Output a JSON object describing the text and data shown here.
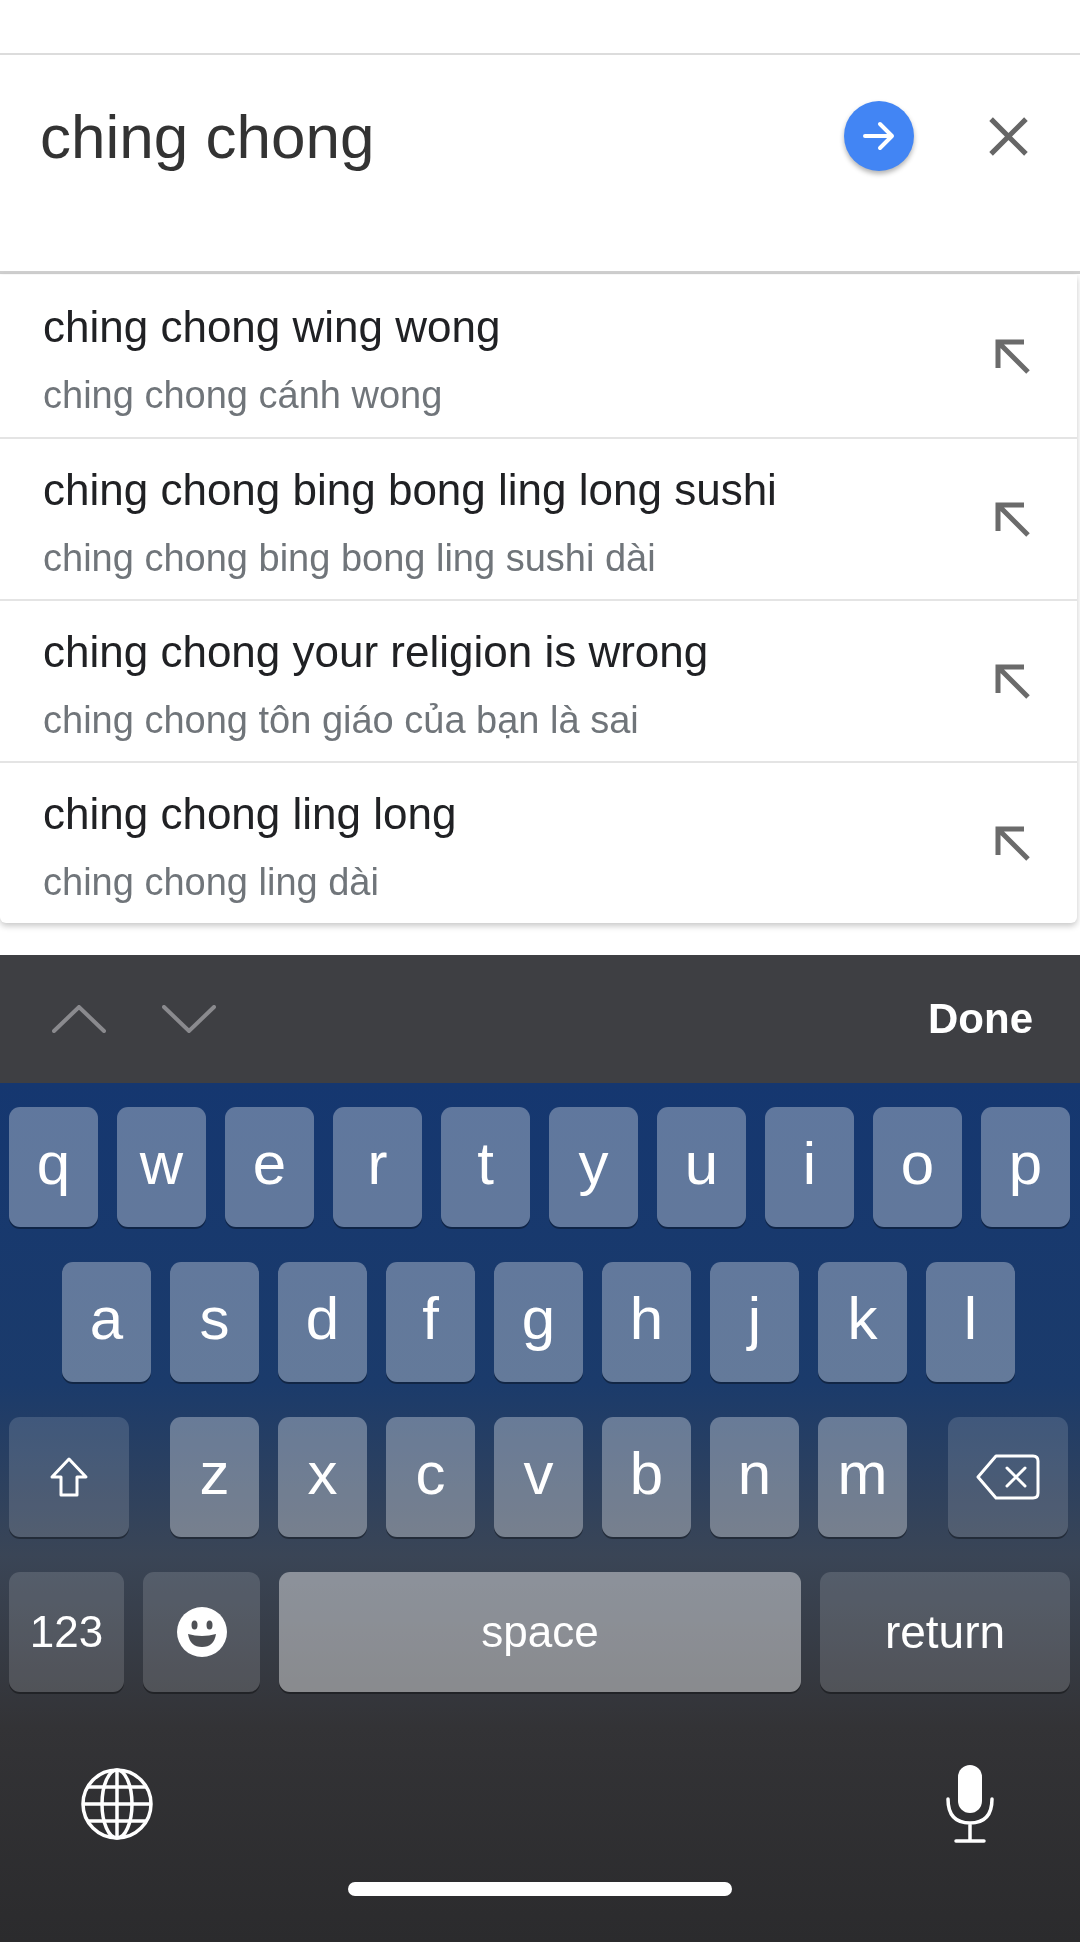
{
  "search": {
    "query": "ching chong"
  },
  "suggestions": [
    {
      "text": "ching chong wing wong",
      "translation": "ching chong cánh wong"
    },
    {
      "text": "ching chong bing bong ling long sushi",
      "translation": "ching chong bing bong ling sushi dài"
    },
    {
      "text": "ching chong your religion is wrong",
      "translation": "ching chong tôn giáo của bạn là sai"
    },
    {
      "text": "ching chong ling long",
      "translation": "ching chong ling dài"
    }
  ],
  "keyboard_toolbar": {
    "done_label": "Done"
  },
  "keyboard": {
    "rows": [
      {
        "keys": [
          {
            "kind": "letter",
            "label": "q"
          },
          {
            "kind": "letter",
            "label": "w"
          },
          {
            "kind": "letter",
            "label": "e"
          },
          {
            "kind": "letter",
            "label": "r"
          },
          {
            "kind": "letter",
            "label": "t"
          },
          {
            "kind": "letter",
            "label": "y"
          },
          {
            "kind": "letter",
            "label": "u"
          },
          {
            "kind": "letter",
            "label": "i"
          },
          {
            "kind": "letter",
            "label": "o"
          },
          {
            "kind": "letter",
            "label": "p"
          }
        ]
      },
      {
        "keys": [
          {
            "kind": "letter",
            "label": "a"
          },
          {
            "kind": "letter",
            "label": "s"
          },
          {
            "kind": "letter",
            "label": "d"
          },
          {
            "kind": "letter",
            "label": "f"
          },
          {
            "kind": "letter",
            "label": "g"
          },
          {
            "kind": "letter",
            "label": "h"
          },
          {
            "kind": "letter",
            "label": "j"
          },
          {
            "kind": "letter",
            "label": "k"
          },
          {
            "kind": "letter",
            "label": "l"
          }
        ]
      },
      {
        "keys": [
          {
            "kind": "shift"
          },
          {
            "kind": "letter",
            "label": "z"
          },
          {
            "kind": "letter",
            "label": "x"
          },
          {
            "kind": "letter",
            "label": "c"
          },
          {
            "kind": "letter",
            "label": "v"
          },
          {
            "kind": "letter",
            "label": "b"
          },
          {
            "kind": "letter",
            "label": "n"
          },
          {
            "kind": "letter",
            "label": "m"
          },
          {
            "kind": "backspace"
          }
        ]
      },
      {
        "keys": [
          {
            "kind": "mode",
            "label": "123"
          },
          {
            "kind": "emoji"
          },
          {
            "kind": "space",
            "label": "space"
          },
          {
            "kind": "return",
            "label": "return"
          }
        ]
      }
    ]
  }
}
